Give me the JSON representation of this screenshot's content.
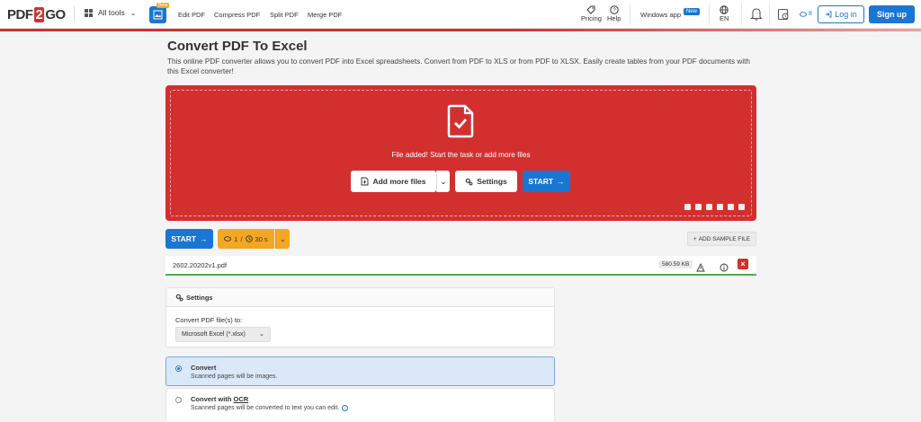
{
  "header": {
    "logo": {
      "part1": "PDF",
      "part2": "2",
      "part3": "GO"
    },
    "all_tools": "All tools",
    "beta_badge": "Beta",
    "nav_links": [
      "Edit PDF",
      "Compress PDF",
      "Split PDF",
      "Merge PDF"
    ],
    "pricing": "Pricing",
    "help": "Help",
    "windows_app": "Windows app",
    "new_badge": "New",
    "language": "EN",
    "credits": "8",
    "login": "Log in",
    "signup": "Sign up"
  },
  "main": {
    "title": "Convert PDF To Excel",
    "description": "This online PDF converter allows you to convert PDF into Excel spreadsheets. Convert from PDF to XLS or from PDF to XLSX. Easily create tables from your PDF documents with this Excel converter!",
    "dropzone": {
      "status": "File added! Start the task or add more files",
      "add_more": "Add more files",
      "settings": "Settings",
      "start": "START"
    },
    "toolbar": {
      "start": "START",
      "credit_count": "1",
      "time": "30 s",
      "add_sample": "ADD SAMPLE FILE"
    },
    "file": {
      "name": "2602.20202v1.pdf",
      "size": "580.59 KB"
    },
    "settings_panel": {
      "heading": "Settings",
      "convert_label": "Convert PDF file(s) to:",
      "selected_format": "Microsoft Excel (*.xlsx)"
    },
    "options": [
      {
        "title": "Convert",
        "desc": "Scanned pages will be images.",
        "selected": true
      },
      {
        "title_prefix": "Convert with ",
        "title_ocr": "OCR",
        "desc": "Scanned pages will be converted to text you can edit.",
        "selected": false
      }
    ]
  },
  "colors": {
    "brand_red": "#d32f2f",
    "primary_blue": "#1976d2",
    "credit_orange": "#f5a623",
    "success_green": "#4caf50"
  }
}
